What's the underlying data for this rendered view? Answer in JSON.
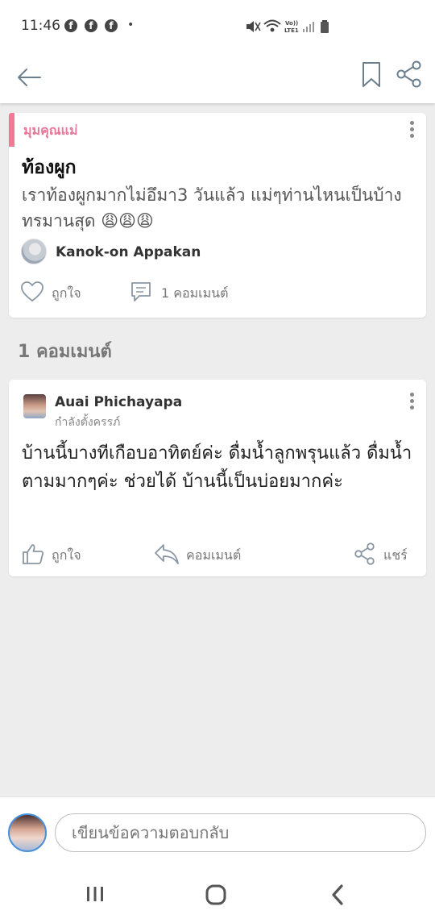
{
  "status_bar": {
    "time": "11:46",
    "notification_icons": [
      "f",
      "f",
      "f"
    ],
    "dot": "•",
    "icons": [
      "mute-icon",
      "wifi-icon",
      "volte-icon",
      "signal-icon",
      "battery-icon"
    ]
  },
  "app_bar": {
    "icons": [
      "back-arrow-icon",
      "bookmark-icon",
      "share-icon"
    ]
  },
  "post": {
    "category": "มุมคุณแม่",
    "title": "ท้องผูก",
    "body": "เราท้องผูกมากไม่อึมา3 วันแล้ว แม่ๆท่านไหนเป็นบ้าง ทรมานสุด 😩😩😩",
    "author": "Kanok-on Appakan",
    "like_label": "ถูกใจ",
    "comment_label": "1 คอมเมนต์"
  },
  "comments_heading": "1 คอมเมนต์",
  "comments": [
    {
      "author": "Auai Phichayapa",
      "status": "กำลังตั้งครรภ์",
      "text": "บ้านนี้บางทีเกือบอาทิตย์ค่ะ ดื่มน้ำลูกพรุนแล้ว ดื่มน้ำตามมากๆค่ะ ช่วยได้ บ้านนี้เป็นบ่อยมากค่ะ",
      "like_label": "ถูกใจ",
      "reply_label": "คอมเมนต์",
      "share_label": "แชร์"
    }
  ],
  "composer": {
    "placeholder": "เขียนข้อความตอบกลับ"
  },
  "colors": {
    "accent": "#f07a95",
    "category_text": "#e8779a",
    "background": "#ededed"
  }
}
